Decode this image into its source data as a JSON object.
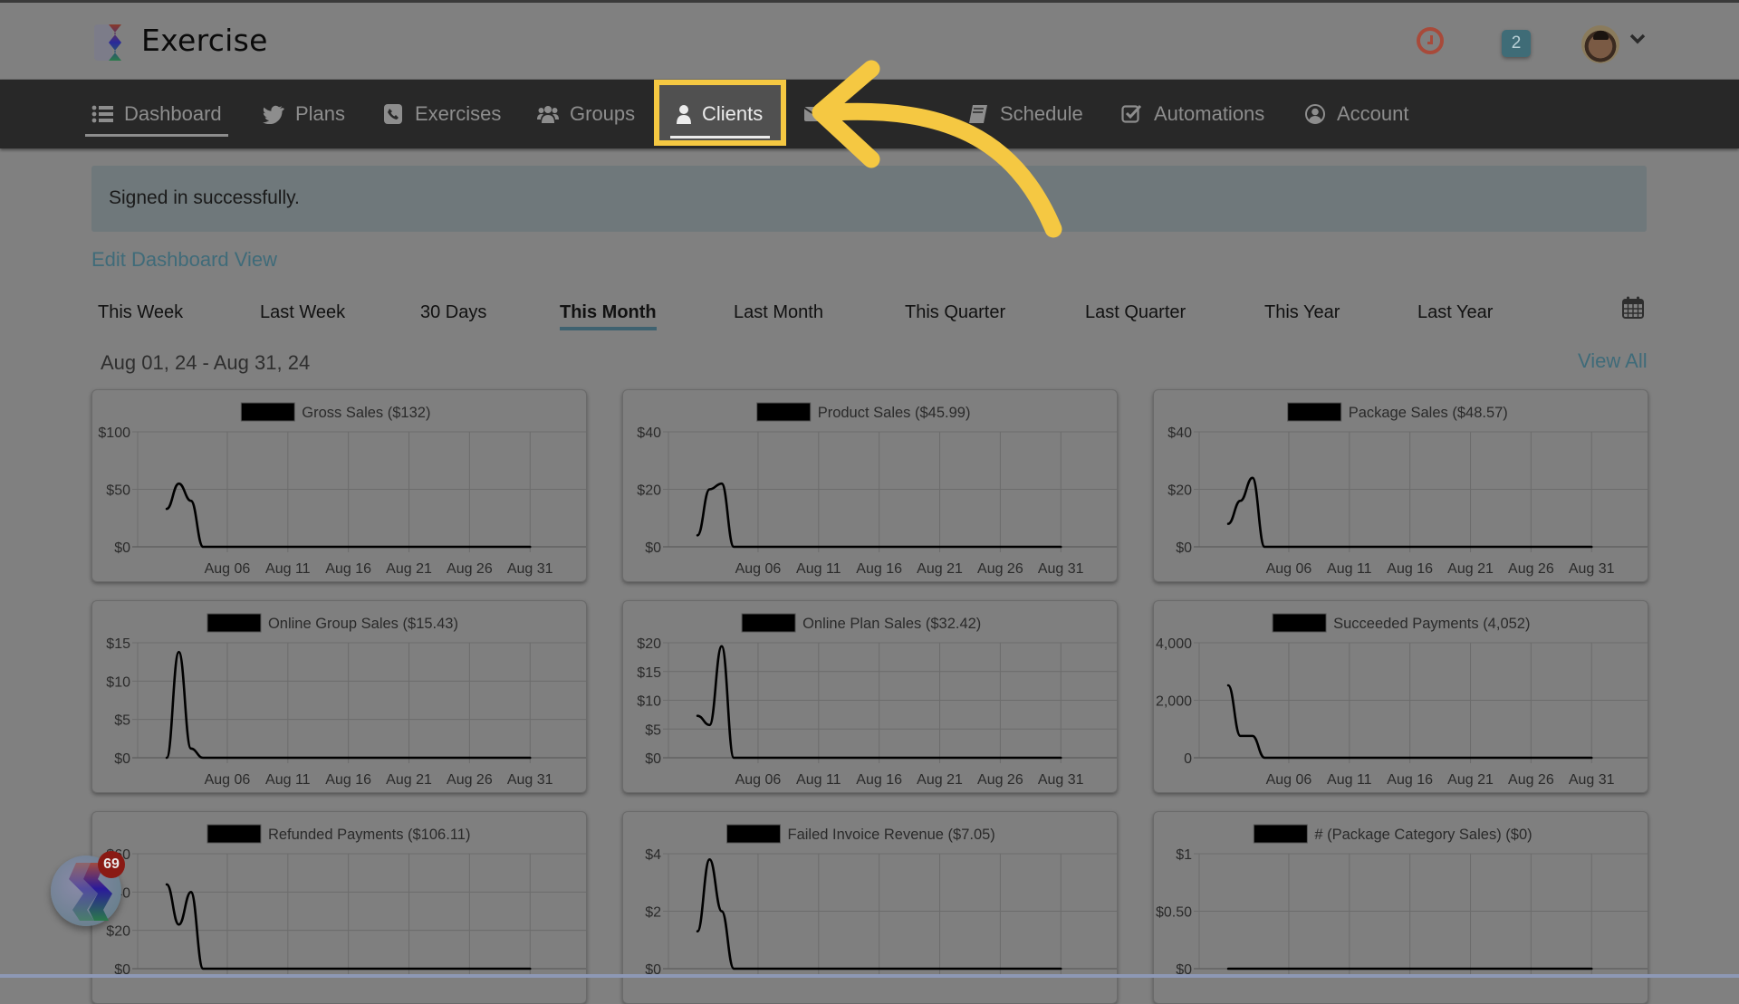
{
  "app": {
    "brand": "Exercise",
    "notification_count": "2",
    "icons": {
      "clock": "clock-icon",
      "avatar": "user-avatar",
      "dropdown": "chevron-down-icon"
    }
  },
  "nav": {
    "items": [
      {
        "label": "Dashboard",
        "icon": "list-icon",
        "state": "current"
      },
      {
        "label": "Plans",
        "icon": "bird-icon"
      },
      {
        "label": "Exercises",
        "icon": "phone-icon"
      },
      {
        "label": "Groups",
        "icon": "users-icon"
      },
      {
        "label": "Clients",
        "icon": "user-icon",
        "state": "highlighted"
      },
      {
        "label": "",
        "icon": "envelope-icon"
      },
      {
        "label": "Schedule",
        "icon": "book-icon"
      },
      {
        "label": "Automations",
        "icon": "checkbox-icon"
      },
      {
        "label": "Account",
        "icon": "user-circle-icon"
      }
    ]
  },
  "alert": {
    "message": "Signed in successfully."
  },
  "dashboard": {
    "edit_link": "Edit Dashboard View",
    "periods": [
      "This Week",
      "Last Week",
      "30 Days",
      "This Month",
      "Last Month",
      "This Quarter",
      "Last Quarter",
      "This Year",
      "Last Year"
    ],
    "active_period": "This Month",
    "date_range": "Aug 01, 24 - Aug 31, 24",
    "view_all": "View All"
  },
  "widget": {
    "badge_count": "69"
  },
  "annotation": {
    "highlight_color": "#F5C842",
    "target": "Clients"
  },
  "chart_data": [
    {
      "type": "line",
      "title": "Gross Sales ($132)",
      "legend": "Gross Sales ($132)",
      "x_ticks": [
        "Aug 06",
        "Aug 11",
        "Aug 16",
        "Aug 21",
        "Aug 26",
        "Aug 31"
      ],
      "y_ticks": [
        "$0",
        "$50",
        "$100"
      ],
      "ylim": [
        0,
        100
      ],
      "x": [
        "Aug 01",
        "Aug 02",
        "Aug 03",
        "Aug 04",
        "Aug 31"
      ],
      "values": [
        33,
        55,
        40,
        0,
        0
      ],
      "grid": true,
      "legend_position": "top"
    },
    {
      "type": "line",
      "title": "Product Sales ($45.99)",
      "legend": "Product Sales ($45.99)",
      "x_ticks": [
        "Aug 06",
        "Aug 11",
        "Aug 16",
        "Aug 21",
        "Aug 26",
        "Aug 31"
      ],
      "y_ticks": [
        "$0",
        "$20",
        "$40"
      ],
      "ylim": [
        0,
        40
      ],
      "x": [
        "Aug 01",
        "Aug 02",
        "Aug 03",
        "Aug 04",
        "Aug 31"
      ],
      "values": [
        4,
        20,
        22,
        0,
        0
      ],
      "grid": true,
      "legend_position": "top"
    },
    {
      "type": "line",
      "title": "Package Sales ($48.57)",
      "legend": "Package Sales ($48.57)",
      "x_ticks": [
        "Aug 06",
        "Aug 11",
        "Aug 16",
        "Aug 21",
        "Aug 26",
        "Aug 31"
      ],
      "y_ticks": [
        "$0",
        "$20",
        "$40"
      ],
      "ylim": [
        0,
        40
      ],
      "x": [
        "Aug 01",
        "Aug 02",
        "Aug 03",
        "Aug 04",
        "Aug 31"
      ],
      "values": [
        8,
        16,
        24,
        0,
        0
      ],
      "grid": true,
      "legend_position": "top"
    },
    {
      "type": "line",
      "title": "Online Group Sales ($15.43)",
      "legend": "Online Group Sales ($15.43)",
      "x_ticks": [
        "Aug 06",
        "Aug 11",
        "Aug 16",
        "Aug 21",
        "Aug 26",
        "Aug 31"
      ],
      "y_ticks": [
        "$0",
        "$5",
        "$10",
        "$15"
      ],
      "ylim": [
        0,
        15
      ],
      "x": [
        "Aug 01",
        "Aug 02",
        "Aug 03",
        "Aug 04",
        "Aug 31"
      ],
      "values": [
        0,
        13.8,
        1.2,
        0,
        0
      ],
      "grid": true,
      "legend_position": "top"
    },
    {
      "type": "line",
      "title": "Online Plan Sales ($32.42)",
      "legend": "Online Plan Sales ($32.42)",
      "x_ticks": [
        "Aug 06",
        "Aug 11",
        "Aug 16",
        "Aug 21",
        "Aug 26",
        "Aug 31"
      ],
      "y_ticks": [
        "$0",
        "$5",
        "$10",
        "$15",
        "$20"
      ],
      "ylim": [
        0,
        20
      ],
      "x": [
        "Aug 01",
        "Aug 02",
        "Aug 03",
        "Aug 04",
        "Aug 31"
      ],
      "values": [
        7.3,
        5.7,
        19.4,
        0,
        0
      ],
      "grid": true,
      "legend_position": "top"
    },
    {
      "type": "line",
      "title": "Succeeded Payments (4,052)",
      "legend": "Succeeded Payments (4,052)",
      "x_ticks": [
        "Aug 06",
        "Aug 11",
        "Aug 16",
        "Aug 21",
        "Aug 26",
        "Aug 31"
      ],
      "y_ticks": [
        "0",
        "2,000",
        "4,000"
      ],
      "ylim": [
        0,
        4000
      ],
      "x": [
        "Aug 01",
        "Aug 02",
        "Aug 03",
        "Aug 04",
        "Aug 31"
      ],
      "values": [
        2520,
        760,
        760,
        0,
        0
      ],
      "grid": true,
      "legend_position": "top"
    },
    {
      "type": "line",
      "title": "Refunded Payments ($106.11)",
      "legend": "Refunded Payments ($106.11)",
      "x_ticks": [],
      "y_ticks": [
        "$0",
        "$20",
        "$40",
        "$60"
      ],
      "ylim": [
        0,
        60
      ],
      "x": [
        "Aug 01",
        "Aug 02",
        "Aug 03",
        "Aug 04",
        "Aug 31"
      ],
      "values": [
        44,
        23,
        40,
        0,
        0
      ],
      "grid": true,
      "legend_position": "top"
    },
    {
      "type": "line",
      "title": "Failed Invoice Revenue ($7.05)",
      "legend": "Failed Invoice Revenue ($7.05)",
      "x_ticks": [],
      "y_ticks": [
        "$0",
        "$2",
        "$4"
      ],
      "ylim": [
        0,
        4
      ],
      "x": [
        "Aug 01",
        "Aug 02",
        "Aug 03",
        "Aug 04",
        "Aug 31"
      ],
      "values": [
        1.3,
        3.8,
        2.0,
        0,
        0
      ],
      "grid": true,
      "legend_position": "top"
    },
    {
      "type": "line",
      "title": "# (Package Category Sales) ($0)",
      "legend": "# (Package Category Sales) ($0)",
      "x_ticks": [],
      "y_ticks": [
        "$0",
        "$0.50",
        "$1"
      ],
      "ylim": [
        0,
        1
      ],
      "x": [
        "Aug 01",
        "Aug 31"
      ],
      "values": [
        0,
        0
      ],
      "grid": true,
      "legend_position": "top"
    }
  ]
}
